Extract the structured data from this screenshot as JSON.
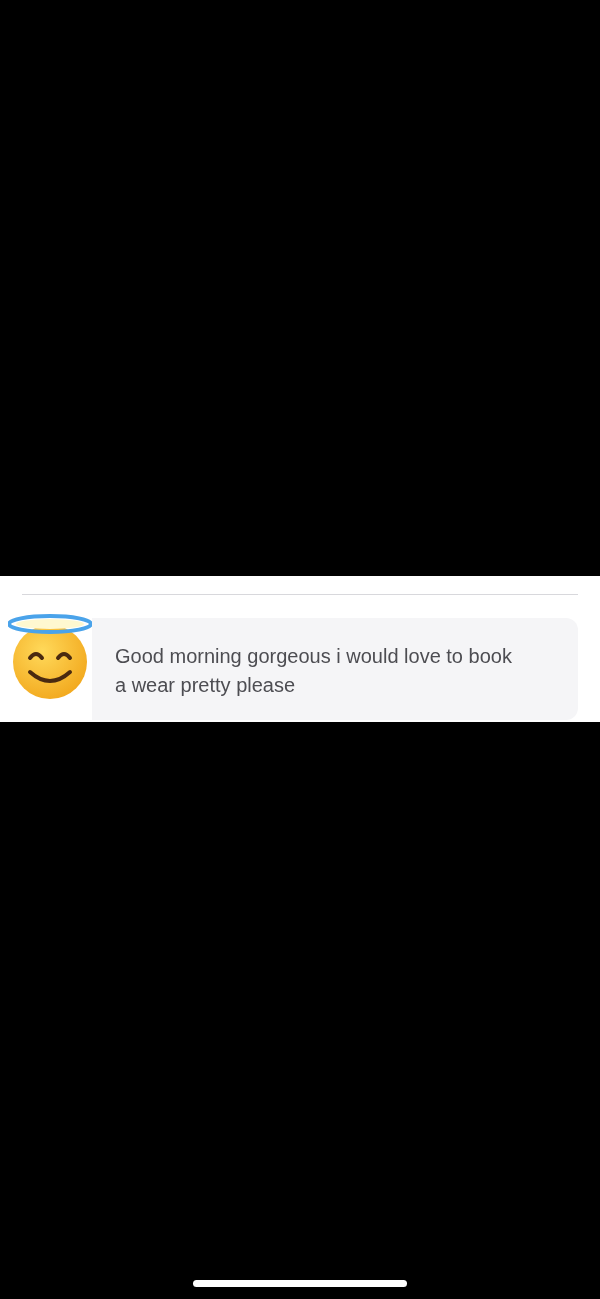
{
  "message": {
    "text": "Good morning gorgeous i would love to book a wear pretty please"
  }
}
